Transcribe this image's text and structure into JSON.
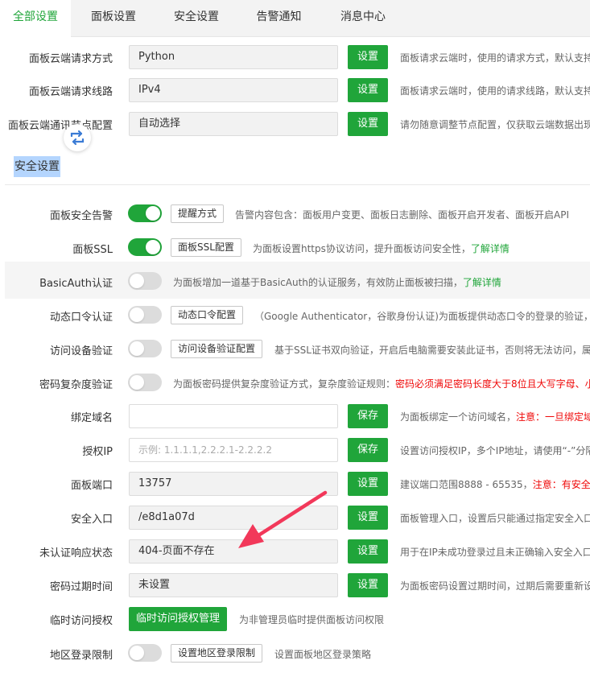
{
  "tabs": [
    {
      "label": "全部设置",
      "active": true
    },
    {
      "label": "面板设置",
      "active": false
    },
    {
      "label": "安全设置",
      "active": false
    },
    {
      "label": "告警通知",
      "active": false
    },
    {
      "label": "消息中心",
      "active": false
    }
  ],
  "top_rows": [
    {
      "label": "面板云端请求方式",
      "value": "Python",
      "button": "设置",
      "desc": "面板请求云端时，使用的请求方式，默认支持"
    },
    {
      "label": "面板云端请求线路",
      "value": "IPv4",
      "button": "设置",
      "desc": "面板请求云端时，使用的请求线路，默认支持"
    },
    {
      "label": "面板云端通讯节点配置",
      "value": "自动选择",
      "button": "设置",
      "desc": "请勿随意调整节点配置，仅获取云端数据出现"
    }
  ],
  "section_title": "安全设置",
  "toggle_rows": [
    {
      "label": "面板安全告警",
      "on": true,
      "button": "提醒方式",
      "desc": "告警内容包含：面板用户变更、面板日志删除、面板开启开发者、面板开启API",
      "link": ""
    },
    {
      "label": "面板SSL",
      "on": true,
      "button": "面板SSL配置",
      "desc": "为面板设置https协议访问，提升面板访问安全性，",
      "link": "了解详情"
    },
    {
      "label": "BasicAuth认证",
      "on": false,
      "button": "",
      "desc": "为面板增加一道基于BasicAuth的认证服务，有效防止面板被扫描，",
      "link": "了解详情"
    },
    {
      "label": "动态口令认证",
      "on": false,
      "button": "动态口令配置",
      "desc": "（Google Authenticator，谷歌身份认证)为面板提供动态口令的登录的验证，同一",
      "link": ""
    },
    {
      "label": "访问设备验证",
      "on": false,
      "button": "访问设备验证配置",
      "desc": "基于SSL证书双向验证，开启后电脑需要安装此证书，否则将无法访问，属",
      "link": ""
    },
    {
      "label": "密码复杂度验证",
      "on": false,
      "button": "",
      "desc": "为面板密码提供复杂度验证方式，复杂度验证规则：",
      "red": "密码必须满足密码长度大于8位且大写字母、小"
    }
  ],
  "input_rows": [
    {
      "label": "绑定域名",
      "value": "",
      "placeholder": "",
      "button": "保存",
      "desc": "为面板绑定一个访问域名，",
      "red": "注意：一旦绑定域"
    },
    {
      "label": "授权IP",
      "value": "",
      "placeholder": "示例: 1.1.1.1,2.2.2.1-2.2.2.2",
      "button": "保存",
      "desc": "设置访问授权IP，多个IP地址，请使用“-”分隔",
      "red": ""
    },
    {
      "label": "面板端口",
      "value": "13757",
      "placeholder": "",
      "button": "设置",
      "desc": "建议端口范围8888 - 65535，",
      "red": "注意：有安全"
    },
    {
      "label": "安全入口",
      "value": "/e8d1a07d",
      "placeholder": "",
      "button": "设置",
      "desc": "面板管理入口，设置后只能通过指定安全入口",
      "red": ""
    },
    {
      "label": "未认证响应状态",
      "value": "404-页面不存在",
      "placeholder": "",
      "button": "设置",
      "desc": "用于在IP未成功登录过且未正确输入安全入口",
      "red": ""
    },
    {
      "label": "密码过期时间",
      "value": "未设置",
      "placeholder": "",
      "button": "设置",
      "desc": "为面板密码设置过期时间，过期后需要重新设",
      "red": ""
    }
  ],
  "temp_access": {
    "label": "临时访问授权",
    "button": "临时访问授权管理",
    "desc": "为非管理员临时提供面板访问权限"
  },
  "region_limit": {
    "label": "地区登录限制",
    "button": "设置地区登录限制",
    "desc": "设置面板地区登录策略"
  },
  "colors": {
    "accent": "#20a53a",
    "warning": "#ef0808",
    "annotation_arrow": "#f2385a",
    "selection": "#b4d5fe"
  }
}
